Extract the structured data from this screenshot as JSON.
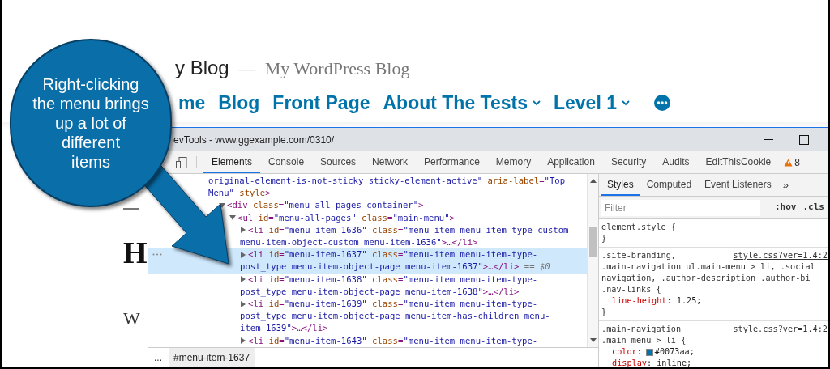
{
  "blog": {
    "site_title": "y Blog",
    "separator": "—",
    "tagline": "My WordPress Blog",
    "nav": [
      {
        "label": "me",
        "dropdown": false
      },
      {
        "label": "Blog",
        "dropdown": false
      },
      {
        "label": "Front Page",
        "dropdown": false
      },
      {
        "label": "About The Tests",
        "dropdown": true
      },
      {
        "label": "Level 1",
        "dropdown": true
      }
    ],
    "heading": "H",
    "paragraph": "W"
  },
  "callout": {
    "text": "Right-clicking\nthe menu brings\nup a lot of\ndifferent\nitems"
  },
  "devtools": {
    "title": "evTools - www.ggexample.com/0310/",
    "tabs": [
      {
        "label": "Elements",
        "selected": true
      },
      {
        "label": "Console",
        "selected": false
      },
      {
        "label": "Sources",
        "selected": false
      },
      {
        "label": "Network",
        "selected": false
      },
      {
        "label": "Performance",
        "selected": false
      },
      {
        "label": "Memory",
        "selected": false
      },
      {
        "label": "Application",
        "selected": false
      },
      {
        "label": "Security",
        "selected": false
      },
      {
        "label": "Audits",
        "selected": false
      },
      {
        "label": "EditThisCookie",
        "selected": false
      }
    ],
    "warning_count": "8",
    "dom_tree": [
      {
        "selected": false,
        "lines": [
          [
            {
              "kind": "value",
              "text": "original-element-is-not-sticky sticky-element-active\""
            },
            {
              "kind": "name",
              "text": " aria-label"
            },
            {
              "kind": "tag",
              "text": "="
            },
            {
              "kind": "value",
              "text": "\"Top"
            }
          ],
          [
            {
              "kind": "value",
              "text": "Menu\""
            },
            {
              "kind": "name",
              "text": " style"
            },
            {
              "kind": "tag",
              "text": ">"
            }
          ]
        ],
        "children": [
          {
            "expanded": true,
            "selected": false,
            "lines": [
              [
                {
                  "kind": "tag",
                  "text": "<div"
                },
                {
                  "kind": "name",
                  "text": " class"
                },
                {
                  "kind": "tag",
                  "text": "="
                },
                {
                  "kind": "value",
                  "text": "\"menu-all-pages-container\""
                },
                {
                  "kind": "tag",
                  "text": ">"
                }
              ]
            ],
            "children": [
              {
                "expanded": true,
                "selected": false,
                "lines": [
                  [
                    {
                      "kind": "tag",
                      "text": "<ul"
                    },
                    {
                      "kind": "name",
                      "text": " id"
                    },
                    {
                      "kind": "tag",
                      "text": "="
                    },
                    {
                      "kind": "value",
                      "text": "\"menu-all-pages\""
                    },
                    {
                      "kind": "name",
                      "text": " class"
                    },
                    {
                      "kind": "tag",
                      "text": "="
                    },
                    {
                      "kind": "value",
                      "text": "\"main-menu\""
                    },
                    {
                      "kind": "tag",
                      "text": ">"
                    }
                  ]
                ],
                "children": [
                  {
                    "expanded": false,
                    "selected": false,
                    "lines": [
                      [
                        {
                          "kind": "tag",
                          "text": "<li"
                        },
                        {
                          "kind": "name",
                          "text": " id"
                        },
                        {
                          "kind": "tag",
                          "text": "="
                        },
                        {
                          "kind": "value",
                          "text": "\"menu-item-1636\""
                        },
                        {
                          "kind": "name",
                          "text": " class"
                        },
                        {
                          "kind": "tag",
                          "text": "="
                        },
                        {
                          "kind": "value",
                          "text": "\"menu-item menu-item-type-custom"
                        }
                      ],
                      [
                        {
                          "kind": "value",
                          "text": "menu-item-object-custom menu-item-1636\""
                        },
                        {
                          "kind": "tag",
                          "text": ">…</li>"
                        }
                      ]
                    ]
                  },
                  {
                    "expanded": false,
                    "selected": true,
                    "lines": [
                      [
                        {
                          "kind": "tag",
                          "text": "<li"
                        },
                        {
                          "kind": "name",
                          "text": " id"
                        },
                        {
                          "kind": "tag",
                          "text": "="
                        },
                        {
                          "kind": "value",
                          "text": "\"menu-item-1637\""
                        },
                        {
                          "kind": "name",
                          "text": " class"
                        },
                        {
                          "kind": "tag",
                          "text": "="
                        },
                        {
                          "kind": "value",
                          "text": "\"menu-item menu-item-type-"
                        }
                      ],
                      [
                        {
                          "kind": "value",
                          "text": "post_type menu-item-object-page menu-item-1637\""
                        },
                        {
                          "kind": "tag",
                          "text": ">…</li>"
                        },
                        {
                          "kind": "hint",
                          "text": " == $0"
                        }
                      ]
                    ]
                  },
                  {
                    "expanded": false,
                    "selected": false,
                    "lines": [
                      [
                        {
                          "kind": "tag",
                          "text": "<li"
                        },
                        {
                          "kind": "name",
                          "text": " id"
                        },
                        {
                          "kind": "tag",
                          "text": "="
                        },
                        {
                          "kind": "value",
                          "text": "\"menu-item-1638\""
                        },
                        {
                          "kind": "name",
                          "text": " class"
                        },
                        {
                          "kind": "tag",
                          "text": "="
                        },
                        {
                          "kind": "value",
                          "text": "\"menu-item menu-item-type-"
                        }
                      ],
                      [
                        {
                          "kind": "value",
                          "text": "post_type menu-item-object-page menu-item-1638\""
                        },
                        {
                          "kind": "tag",
                          "text": ">…</li>"
                        }
                      ]
                    ]
                  },
                  {
                    "expanded": false,
                    "selected": false,
                    "lines": [
                      [
                        {
                          "kind": "tag",
                          "text": "<li"
                        },
                        {
                          "kind": "name",
                          "text": " id"
                        },
                        {
                          "kind": "tag",
                          "text": "="
                        },
                        {
                          "kind": "value",
                          "text": "\"menu-item-1639\""
                        },
                        {
                          "kind": "name",
                          "text": " class"
                        },
                        {
                          "kind": "tag",
                          "text": "="
                        },
                        {
                          "kind": "value",
                          "text": "\"menu-item menu-item-type-"
                        }
                      ],
                      [
                        {
                          "kind": "value",
                          "text": "post_type menu-item-object-page menu-item-has-children menu-"
                        }
                      ],
                      [
                        {
                          "kind": "value",
                          "text": "item-1639\""
                        },
                        {
                          "kind": "tag",
                          "text": ">…</li>"
                        }
                      ]
                    ]
                  },
                  {
                    "expanded": false,
                    "selected": false,
                    "lines": [
                      [
                        {
                          "kind": "tag",
                          "text": "<li"
                        },
                        {
                          "kind": "name",
                          "text": " id"
                        },
                        {
                          "kind": "tag",
                          "text": "="
                        },
                        {
                          "kind": "value",
                          "text": "\"menu-item-1643\""
                        },
                        {
                          "kind": "name",
                          "text": " class"
                        },
                        {
                          "kind": "tag",
                          "text": "="
                        },
                        {
                          "kind": "value",
                          "text": "\"menu-item menu-item-type-"
                        }
                      ]
                    ]
                  }
                ]
              }
            ]
          }
        ]
      }
    ],
    "breadcrumb": {
      "more": "...",
      "current": "#menu-item-1637"
    },
    "styles": {
      "tabs": [
        {
          "label": "Styles",
          "selected": true
        },
        {
          "label": "Computed",
          "selected": false
        },
        {
          "label": "Event Listeners",
          "selected": false
        }
      ],
      "more_tabs": "»",
      "filter": {
        "placeholder": "Filter"
      },
      "hov": ":hov",
      "cls": ".cls",
      "rules": [
        {
          "selector_lines": [
            "element.style {"
          ],
          "close": "}"
        },
        {
          "selector_lines": [
            ".site-branding,",
            ".main-navigation ul.main-menu > li, .social",
            "navigation, .author-description .author-bi",
            ".nav-links {"
          ],
          "source": "style.css?ver=1.4:2",
          "props": [
            {
              "name": "line-height",
              "colon": ":",
              "value": " 1.25;"
            }
          ],
          "close": "}"
        },
        {
          "selector_lines": [
            ".main-navigation",
            ".main-menu > li {"
          ],
          "source": "style.css?ver=1.4:2",
          "props": [
            {
              "name": "color",
              "colon": ":",
              "value": "#0073aa;",
              "color": "#0073aa"
            },
            {
              "name": "display",
              "colon": ":",
              "value": " inline;"
            }
          ]
        }
      ]
    }
  }
}
